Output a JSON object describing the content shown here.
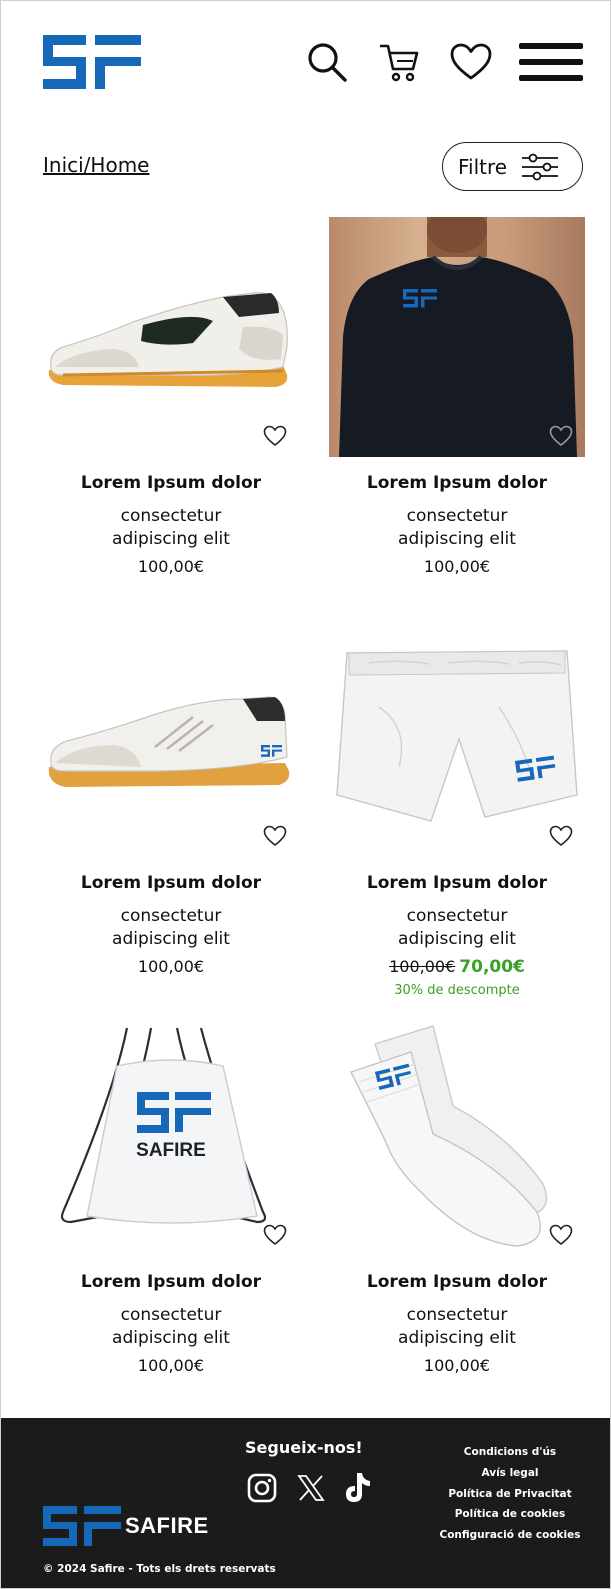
{
  "header": {
    "breadcrumb": "Inici/Home",
    "filter_label": "Filtre"
  },
  "colors": {
    "brand_blue": "#1668b8",
    "sale_green": "#3aa024",
    "footer_bg": "#1b1b1b"
  },
  "icons": [
    "search-icon",
    "cart-icon",
    "heart-icon",
    "menu-icon",
    "filter-icon",
    "instagram-icon",
    "x-icon",
    "tiktok-icon"
  ],
  "products": [
    {
      "name": "Lorem Ipsum dolor",
      "desc1": "consectetur",
      "desc2": "adipiscing elit",
      "price": "100,00€",
      "image": "white indoor sneaker"
    },
    {
      "name": "Lorem Ipsum dolor",
      "desc1": "consectetur",
      "desc2": "adipiscing elit",
      "price": "100,00€",
      "image": "black t-shirt with SF logo"
    },
    {
      "name": "Lorem Ipsum dolor",
      "desc1": "consectetur",
      "desc2": "adipiscing elit",
      "price": "100,00€",
      "image": "white sneaker with SF logo"
    },
    {
      "name": "Lorem Ipsum dolor",
      "desc1": "consectetur",
      "desc2": "adipiscing elit",
      "old_price": "100,00€",
      "sale_price": "70,00€",
      "discount": "30% de descompte",
      "image": "white shorts with SF logo"
    },
    {
      "name": "Lorem Ipsum dolor",
      "desc1": "consectetur",
      "desc2": "adipiscing elit",
      "price": "100,00€",
      "image": "white drawstring bag",
      "bag_text": "SAFIRE"
    },
    {
      "name": "Lorem Ipsum dolor",
      "desc1": "consectetur",
      "desc2": "adipiscing elit",
      "price": "100,00€",
      "image": "white socks with SF logo"
    }
  ],
  "footer": {
    "brand": "SAFIRE",
    "copyright": "© 2024 Safire - Tots els drets reservats",
    "follow": "Segueix-nos!",
    "links": [
      "Condicions d'ús",
      "Avís legal",
      "Política de Privacitat",
      "Política de cookies",
      "Configuració de cookies"
    ]
  }
}
